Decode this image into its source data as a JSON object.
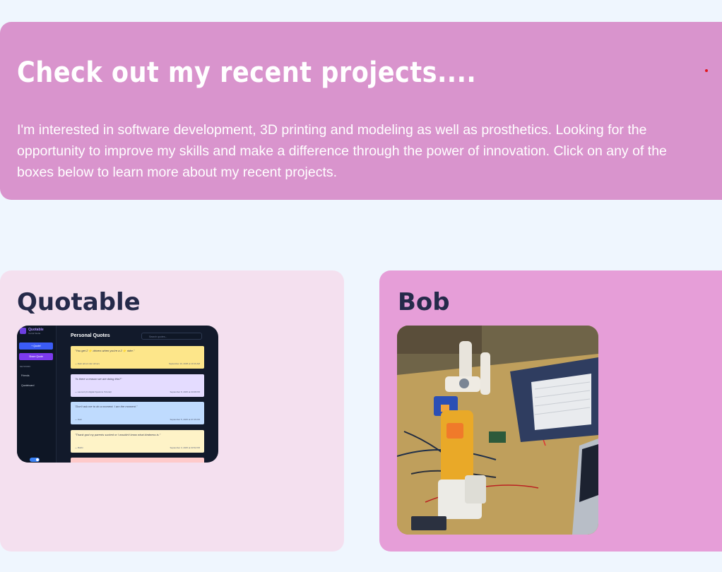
{
  "hero": {
    "title": "Check out my recent projects....",
    "text": "I'm interested in software development, 3D printing and modeling as well as prosthetics. Looking for the opportunity to improve my skills and make a difference through the power of innovation. Click on any of the boxes below to learn more about my recent projects."
  },
  "projects": [
    {
      "title": "Quotable",
      "screenshot": {
        "brand": "Quotable",
        "brand_sub": "Social Media",
        "button_quote": "+ Quote!",
        "button_share": "Share Quote",
        "nav_heading": "NETWORK",
        "nav_items": [
          "Friends",
          "Quoteboard"
        ],
        "page_title": "Personal Quotes",
        "search_placeholder": "Search quotes...",
        "quotes": [
          {
            "text": "\"You get 2 ⭐ drivers when you're a 2 ⭐ rider.\"",
            "author": "— Dalo about uber drivers",
            "date": "September 10, 2025 at 10:16 AM"
          },
          {
            "text": "\"Is there a reason we are doing this?\"",
            "author": "— Laura D (in Digital Systems Tutorial)",
            "date": "September 8, 2025 at 03:08 PM"
          },
          {
            "text": "\"Don't ask me to do a moment. I am the moment.\"",
            "author": "— Dalo",
            "date": "September 5, 2025 at 07:25 PM"
          },
          {
            "text": "\"Thank god my parents sucked or I wouldn't know what kindness is.\"",
            "author": "— Bobbi",
            "date": "September 3, 2025 at 03:52 PM"
          }
        ]
      }
    },
    {
      "title": "Bob"
    }
  ]
}
